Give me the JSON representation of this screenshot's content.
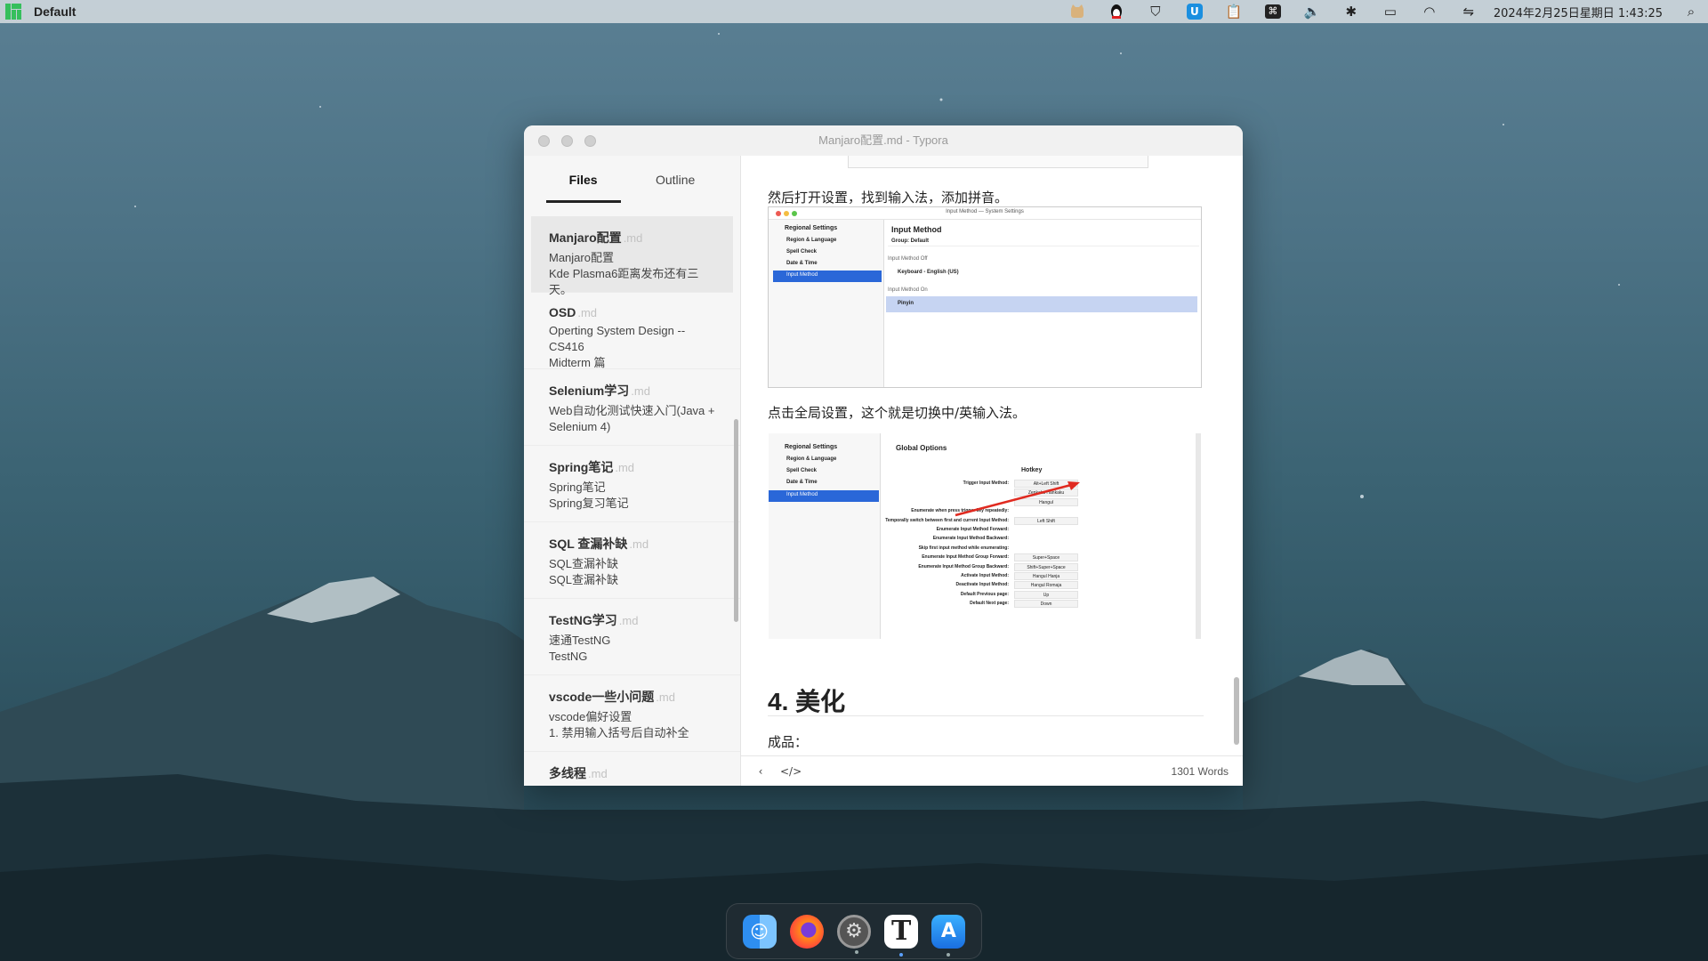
{
  "topbar": {
    "app_name": "Default",
    "clock": "2024年2月25日星期日  1:43:25"
  },
  "tray": {
    "icons": [
      "cat-icon",
      "penguin-icon",
      "shield-icon",
      "u-app-icon",
      "clipboard-icon",
      "command-icon",
      "volume-icon",
      "bluetooth-icon",
      "display-icon",
      "wifi-icon",
      "toggle-icon",
      "search-icon"
    ]
  },
  "window": {
    "title": "Manjaro配置.md - Typora"
  },
  "sidebar": {
    "tabs": [
      "Files",
      "Outline"
    ],
    "files": [
      {
        "name": "Manjaro配置",
        "ext": ".md",
        "line1": "Manjaro配置",
        "line2": "Kde Plasma6距离发布还有三天。"
      },
      {
        "name": "OSD",
        "ext": ".md",
        "line1": "Operting System Design -- CS416",
        "line2": "Midterm 篇"
      },
      {
        "name": "Selenium学习",
        "ext": ".md",
        "line1": "Web自动化测试快速入门(Java +",
        "line2": "Selenium 4)"
      },
      {
        "name": "Spring笔记",
        "ext": ".md",
        "line1": "Spring笔记",
        "line2": "Spring复习笔记"
      },
      {
        "name": "SQL 查漏补缺",
        "ext": ".md",
        "line1": "SQL查漏补缺",
        "line2": "SQL查漏补缺"
      },
      {
        "name": "TestNG学习",
        "ext": ".md",
        "line1": "速通TestNG",
        "line2": "TestNG"
      },
      {
        "name": "vscode一些小问题",
        "ext": ".md",
        "line1": "vscode偏好设置",
        "line2": "1. 禁用输入括号后自动补全"
      },
      {
        "name": "多线程",
        "ext": ".md",
        "line1": "",
        "line2": ""
      }
    ]
  },
  "editor": {
    "para1": "然后打开设置，找到输入法，添加拼音。",
    "para2": "点击全局设置，这个就是切换中/英输入法。",
    "heading": "4. 美化",
    "para3": "成品："
  },
  "shot1": {
    "title": "Input Method — System Settings",
    "sidebar_title": "Regional Settings",
    "items": [
      "Region & Language",
      "Spell Check",
      "Date & Time",
      "Input Method"
    ],
    "header": "Input Method",
    "group": "Group:  Default",
    "off_label": "Input Method Off",
    "keyboard": "Keyboard - English (US)",
    "on_label": "Input Method On",
    "pinyin": "Pinyin"
  },
  "shot2": {
    "sidebar_title": "Regional Settings",
    "items": [
      "Region & Language",
      "Spell Check",
      "Date & Time",
      "Input Method"
    ],
    "header": "Global Options",
    "hotkey": "Hotkey",
    "rows": [
      {
        "label": "Trigger Input Method:",
        "value": "Alt+Left Shift"
      },
      {
        "label": "",
        "value": "Zenkaku Hankaku"
      },
      {
        "label": "",
        "value": "Hangul"
      },
      {
        "label": "Enumerate when press trigger key repeatedly:",
        "value": ""
      },
      {
        "label": "Temporally switch between first and current Input Method:",
        "value": "Left Shift"
      },
      {
        "label": "Enumerate Input Method Forward:",
        "value": ""
      },
      {
        "label": "Enumerate Input Method Backward:",
        "value": ""
      },
      {
        "label": "Skip first input method while enumerating:",
        "value": ""
      },
      {
        "label": "Enumerate Input Method Group Forward:",
        "value": "Super+Space"
      },
      {
        "label": "Enumerate Input Method Group Backward:",
        "value": "Shift+Super+Space"
      },
      {
        "label": "Activate Input Method:",
        "value": "Hangul Hanja"
      },
      {
        "label": "Deactivate Input Method:",
        "value": "Hangul Romaja"
      },
      {
        "label": "Default Previous page:",
        "value": "Up"
      },
      {
        "label": "Default Next page:",
        "value": "Down"
      }
    ]
  },
  "status": {
    "word_count": "1301 Words"
  },
  "dock": {
    "apps": [
      "finder-icon",
      "firefox-icon",
      "settings-icon",
      "typora-icon",
      "appstore-icon"
    ]
  }
}
